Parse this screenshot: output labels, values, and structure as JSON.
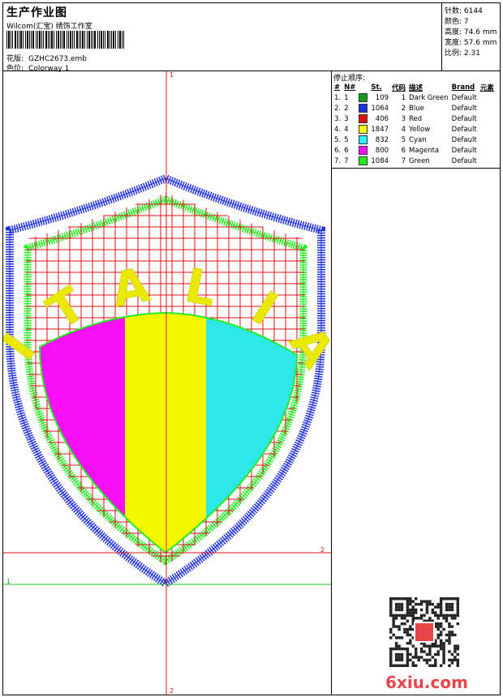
{
  "header": {
    "title": "生产作业图",
    "subtitle": "Wilcom(汇宝) 绣饰工作室",
    "design_label": "花版:",
    "design_value": "GZHC2673.emb",
    "colorway_label": "色位:",
    "colorway_value": "Colorway 1"
  },
  "stats": [
    {
      "label": "针数:",
      "value": "6144"
    },
    {
      "label": "颜色:",
      "value": "7"
    },
    {
      "label": "高度:",
      "value": "74.6 mm"
    },
    {
      "label": "宽度:",
      "value": "57.6 mm"
    },
    {
      "label": "比例:",
      "value": "2.31"
    }
  ],
  "sequence": {
    "title": "停止顺序:",
    "headers": [
      "#",
      "N#",
      "St.",
      "代码",
      "描述",
      "Brand",
      "元素"
    ],
    "rows": [
      {
        "idx": "1.",
        "n": "1",
        "color": "#1a9a1a",
        "st": "109",
        "code": "1",
        "desc": "Dark Green",
        "brand": "Default"
      },
      {
        "idx": "2.",
        "n": "2",
        "color": "#1f2fe0",
        "st": "1064",
        "code": "2",
        "desc": "Blue",
        "brand": "Default"
      },
      {
        "idx": "3.",
        "n": "3",
        "color": "#e01010",
        "st": "406",
        "code": "3",
        "desc": "Red",
        "brand": "Default"
      },
      {
        "idx": "4.",
        "n": "4",
        "color": "#ffff00",
        "st": "1847",
        "code": "4",
        "desc": "Yellow",
        "brand": "Default"
      },
      {
        "idx": "5.",
        "n": "5",
        "color": "#2ff0f0",
        "st": "832",
        "code": "5",
        "desc": "Cyan",
        "brand": "Default"
      },
      {
        "idx": "6.",
        "n": "6",
        "color": "#ff10ff",
        "st": "800",
        "code": "6",
        "desc": "Magenta",
        "brand": "Default"
      },
      {
        "idx": "7.",
        "n": "7",
        "color": "#22ee22",
        "st": "1084",
        "code": "7",
        "desc": "Green",
        "brand": "Default"
      }
    ]
  },
  "design": {
    "word": "ITALIA",
    "stripe_colors": [
      "#ff10ff",
      "#ffff00",
      "#2ff0f0"
    ],
    "outline_colors": {
      "blue": "#1f2fe0",
      "green": "#22ee22",
      "red": "#e01010"
    }
  },
  "axis_labels": {
    "top": "1",
    "right": "2",
    "left": "1",
    "bottom": "2"
  },
  "watermark": "6xiu.com"
}
